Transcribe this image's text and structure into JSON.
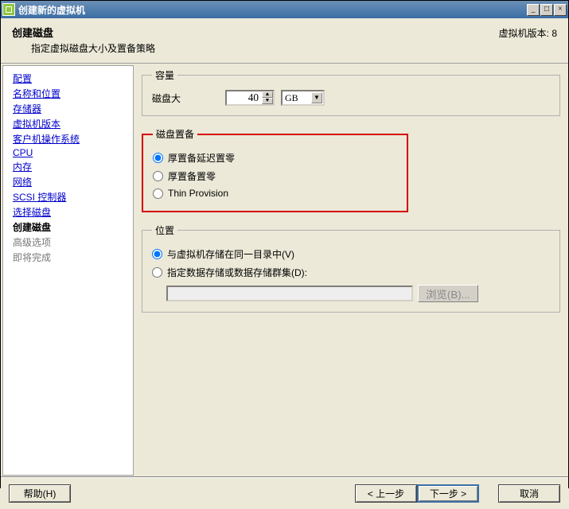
{
  "window": {
    "title": "创建新的虚拟机"
  },
  "header": {
    "title": "创建磁盘",
    "subtitle": "指定虚拟磁盘大小及置备策略",
    "version_label": "虚拟机版本: 8"
  },
  "nav": {
    "items": [
      {
        "label": "配置",
        "state": "link"
      },
      {
        "label": "名称和位置",
        "state": "link"
      },
      {
        "label": "存储器",
        "state": "link"
      },
      {
        "label": "虚拟机版本",
        "state": "link"
      },
      {
        "label": "客户机操作系统",
        "state": "link"
      },
      {
        "label": "CPU",
        "state": "link"
      },
      {
        "label": "内存",
        "state": "link"
      },
      {
        "label": "网络",
        "state": "link"
      },
      {
        "label": "SCSI 控制器",
        "state": "link"
      },
      {
        "label": "选择磁盘",
        "state": "link"
      },
      {
        "label": "创建磁盘",
        "state": "current"
      },
      {
        "label": "高级选项",
        "state": "future"
      },
      {
        "label": "即将完成",
        "state": "future"
      }
    ]
  },
  "capacity": {
    "legend": "容量",
    "size_label": "磁盘大",
    "size_value": "40",
    "unit_value": "GB"
  },
  "provisioning": {
    "legend": "磁盘置备",
    "options": [
      {
        "label": "厚置备延迟置零",
        "checked": true
      },
      {
        "label": "厚置备置零",
        "checked": false
      },
      {
        "label": "Thin Provision",
        "checked": false
      }
    ]
  },
  "location": {
    "legend": "位置",
    "options": [
      {
        "label": "与虚拟机存储在同一目录中(V)",
        "checked": true
      },
      {
        "label": "指定数据存储或数据存储群集(D):",
        "checked": false
      }
    ],
    "browse_label": "浏览(B)..."
  },
  "footer": {
    "help": "帮助(H)",
    "back": "< 上一步",
    "next": "下一步 >",
    "cancel": "取消"
  }
}
